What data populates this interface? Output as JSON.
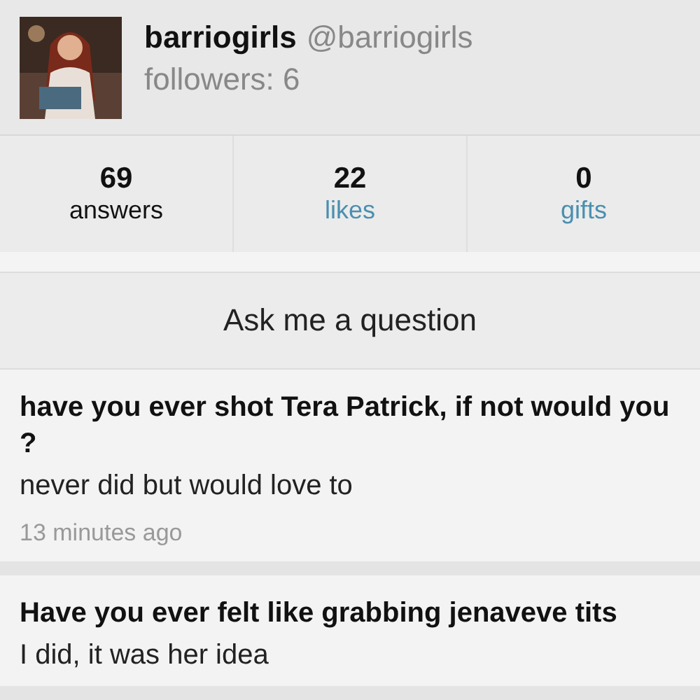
{
  "profile": {
    "name": "barriogirls",
    "handle": "@barriogirls",
    "followers": "followers: 6"
  },
  "stats": [
    {
      "count": "69",
      "label": "answers",
      "selected": true
    },
    {
      "count": "22",
      "label": "likes",
      "selected": false
    },
    {
      "count": "0",
      "label": "gifts",
      "selected": false
    }
  ],
  "ask_button": "Ask me a question",
  "answers": [
    {
      "question": "have you ever shot Tera Patrick, if not would you ?",
      "answer": "never did but would love to",
      "time": "13 minutes ago"
    },
    {
      "question": "Have you ever felt like grabbing jenaveve tits",
      "answer": "I did, it was her idea"
    }
  ]
}
